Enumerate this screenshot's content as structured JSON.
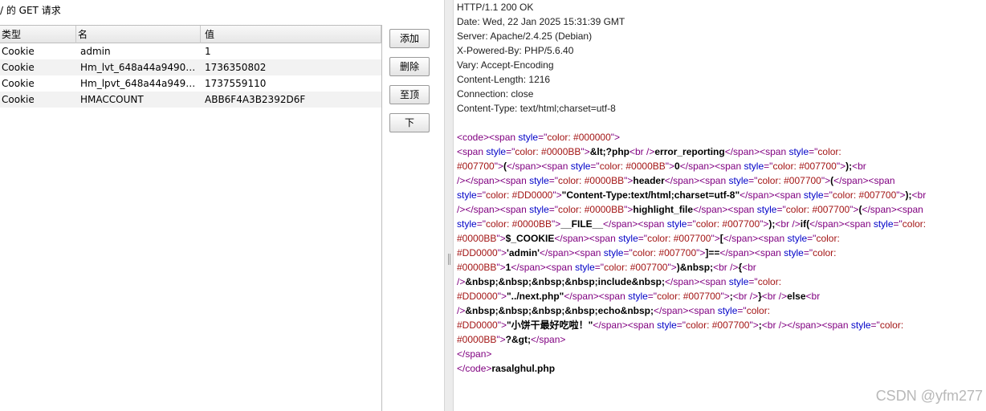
{
  "left": {
    "title": "/ 的 GET 请求",
    "columns": [
      "类型",
      "名",
      "值"
    ],
    "rows": [
      {
        "type": "Cookie",
        "name": "admin",
        "value": "1"
      },
      {
        "type": "Cookie",
        "name": "Hm_lvt_648a44a949074...",
        "value": "1736350802"
      },
      {
        "type": "Cookie",
        "name": "Hm_lpvt_648a44a9490...",
        "value": "1737559110"
      },
      {
        "type": "Cookie",
        "name": "HMACCOUNT",
        "value": "ABB6F4A3B2392D6F"
      }
    ],
    "buttons": {
      "add": "添加",
      "delete": "删除",
      "top": "至顶",
      "down": "下"
    }
  },
  "response": {
    "headers": [
      "HTTP/1.1 200 OK",
      "Date: Wed, 22 Jan 2025 15:31:39 GMT",
      "Server: Apache/2.4.25 (Debian)",
      "X-Powered-By: PHP/5.6.40",
      "Vary: Accept-Encoding",
      "Content-Length: 1216",
      "Connection: close",
      "Content-Type: text/html;charset=utf-8"
    ],
    "body_lines": [
      [
        [
          "tag",
          "<code><span "
        ],
        [
          "attr",
          "style"
        ],
        [
          "tag",
          "=\""
        ],
        [
          "val",
          "color: #000000"
        ],
        [
          "tag",
          "\">"
        ]
      ],
      [
        [
          "tag",
          "<span "
        ],
        [
          "attr",
          "style"
        ],
        [
          "tag",
          "=\""
        ],
        [
          "val",
          "color: #0000BB"
        ],
        [
          "tag",
          "\">"
        ],
        [
          "txt",
          "&lt;?php"
        ],
        [
          "tag",
          "<br />"
        ],
        [
          "txt",
          "error_reporting"
        ],
        [
          "tag",
          "</span><span "
        ],
        [
          "attr",
          "style"
        ],
        [
          "tag",
          "=\""
        ],
        [
          "val",
          "color:"
        ]
      ],
      [
        [
          "val",
          "#007700"
        ],
        [
          "tag",
          "\">"
        ],
        [
          "txt",
          "("
        ],
        [
          "tag",
          "</span><span "
        ],
        [
          "attr",
          "style"
        ],
        [
          "tag",
          "=\""
        ],
        [
          "val",
          "color: #0000BB"
        ],
        [
          "tag",
          "\">"
        ],
        [
          "txt",
          "0"
        ],
        [
          "tag",
          "</span><span "
        ],
        [
          "attr",
          "style"
        ],
        [
          "tag",
          "=\""
        ],
        [
          "val",
          "color: #007700"
        ],
        [
          "tag",
          "\">"
        ],
        [
          "txt",
          ");"
        ],
        [
          "tag",
          "<br"
        ]
      ],
      [
        [
          "tag",
          "/></span><span "
        ],
        [
          "attr",
          "style"
        ],
        [
          "tag",
          "=\""
        ],
        [
          "val",
          "color: #0000BB"
        ],
        [
          "tag",
          "\">"
        ],
        [
          "txt",
          "header"
        ],
        [
          "tag",
          "</span><span "
        ],
        [
          "attr",
          "style"
        ],
        [
          "tag",
          "=\""
        ],
        [
          "val",
          "color: #007700"
        ],
        [
          "tag",
          "\">"
        ],
        [
          "txt",
          "("
        ],
        [
          "tag",
          "</span><span"
        ]
      ],
      [
        [
          "attr",
          "style"
        ],
        [
          "tag",
          "=\""
        ],
        [
          "val",
          "color: #DD0000"
        ],
        [
          "tag",
          "\">"
        ],
        [
          "txt",
          "\"Content-Type:text/html;charset=utf-8\""
        ],
        [
          "tag",
          "</span><span "
        ],
        [
          "attr",
          "style"
        ],
        [
          "tag",
          "=\""
        ],
        [
          "val",
          "color: #007700"
        ],
        [
          "tag",
          "\">"
        ],
        [
          "txt",
          ");"
        ],
        [
          "tag",
          "<br"
        ]
      ],
      [
        [
          "tag",
          "/></span><span "
        ],
        [
          "attr",
          "style"
        ],
        [
          "tag",
          "=\""
        ],
        [
          "val",
          "color: #0000BB"
        ],
        [
          "tag",
          "\">"
        ],
        [
          "txt",
          "highlight_file"
        ],
        [
          "tag",
          "</span><span "
        ],
        [
          "attr",
          "style"
        ],
        [
          "tag",
          "=\""
        ],
        [
          "val",
          "color: #007700"
        ],
        [
          "tag",
          "\">"
        ],
        [
          "txt",
          "("
        ],
        [
          "tag",
          "</span><span"
        ]
      ],
      [
        [
          "attr",
          "style"
        ],
        [
          "tag",
          "=\""
        ],
        [
          "val",
          "color: #0000BB"
        ],
        [
          "tag",
          "\">"
        ],
        [
          "txt",
          "__FILE__"
        ],
        [
          "tag",
          "</span><span "
        ],
        [
          "attr",
          "style"
        ],
        [
          "tag",
          "=\""
        ],
        [
          "val",
          "color: #007700"
        ],
        [
          "tag",
          "\">"
        ],
        [
          "txt",
          ");"
        ],
        [
          "tag",
          "<br />"
        ],
        [
          "txt",
          "if("
        ],
        [
          "tag",
          "</span><span "
        ],
        [
          "attr",
          "style"
        ],
        [
          "tag",
          "=\""
        ],
        [
          "val",
          "color:"
        ]
      ],
      [
        [
          "val",
          "#0000BB"
        ],
        [
          "tag",
          "\">"
        ],
        [
          "txt",
          "$_COOKIE"
        ],
        [
          "tag",
          "</span><span "
        ],
        [
          "attr",
          "style"
        ],
        [
          "tag",
          "=\""
        ],
        [
          "val",
          "color: #007700"
        ],
        [
          "tag",
          "\">"
        ],
        [
          "txt",
          "["
        ],
        [
          "tag",
          "</span><span "
        ],
        [
          "attr",
          "style"
        ],
        [
          "tag",
          "=\""
        ],
        [
          "val",
          "color:"
        ]
      ],
      [
        [
          "val",
          "#DD0000"
        ],
        [
          "tag",
          "\">"
        ],
        [
          "txt",
          "'admin'"
        ],
        [
          "tag",
          "</span><span "
        ],
        [
          "attr",
          "style"
        ],
        [
          "tag",
          "=\""
        ],
        [
          "val",
          "color: #007700"
        ],
        [
          "tag",
          "\">"
        ],
        [
          "txt",
          "]=="
        ],
        [
          "tag",
          "</span><span "
        ],
        [
          "attr",
          "style"
        ],
        [
          "tag",
          "=\""
        ],
        [
          "val",
          "color:"
        ]
      ],
      [
        [
          "val",
          "#0000BB"
        ],
        [
          "tag",
          "\">"
        ],
        [
          "txt",
          "1"
        ],
        [
          "tag",
          "</span><span "
        ],
        [
          "attr",
          "style"
        ],
        [
          "tag",
          "=\""
        ],
        [
          "val",
          "color: #007700"
        ],
        [
          "tag",
          "\">"
        ],
        [
          "txt",
          ")&nbsp;"
        ],
        [
          "tag",
          "<br />"
        ],
        [
          "txt",
          "{"
        ],
        [
          "tag",
          "<br"
        ]
      ],
      [
        [
          "tag",
          "/>"
        ],
        [
          "txt",
          "&nbsp;&nbsp;&nbsp;&nbsp;include&nbsp;"
        ],
        [
          "tag",
          "</span><span "
        ],
        [
          "attr",
          "style"
        ],
        [
          "tag",
          "=\""
        ],
        [
          "val",
          "color:"
        ]
      ],
      [
        [
          "val",
          "#DD0000"
        ],
        [
          "tag",
          "\">"
        ],
        [
          "txt",
          "\"../next.php\""
        ],
        [
          "tag",
          "</span><span "
        ],
        [
          "attr",
          "style"
        ],
        [
          "tag",
          "=\""
        ],
        [
          "val",
          "color: #007700"
        ],
        [
          "tag",
          "\">"
        ],
        [
          "txt",
          ";"
        ],
        [
          "tag",
          "<br />"
        ],
        [
          "txt",
          "}"
        ],
        [
          "tag",
          "<br />"
        ],
        [
          "txt",
          "else"
        ],
        [
          "tag",
          "<br"
        ]
      ],
      [
        [
          "tag",
          "/>"
        ],
        [
          "txt",
          "&nbsp;&nbsp;&nbsp;&nbsp;echo&nbsp;"
        ],
        [
          "tag",
          "</span><span "
        ],
        [
          "attr",
          "style"
        ],
        [
          "tag",
          "=\""
        ],
        [
          "val",
          "color:"
        ]
      ],
      [
        [
          "val",
          "#DD0000"
        ],
        [
          "tag",
          "\">"
        ],
        [
          "txt",
          "\"小饼干最好吃啦！\""
        ],
        [
          "tag",
          "</span><span "
        ],
        [
          "attr",
          "style"
        ],
        [
          "tag",
          "=\""
        ],
        [
          "val",
          "color: #007700"
        ],
        [
          "tag",
          "\">"
        ],
        [
          "txt",
          ";"
        ],
        [
          "tag",
          "<br /></span><span "
        ],
        [
          "attr",
          "style"
        ],
        [
          "tag",
          "=\""
        ],
        [
          "val",
          "color:"
        ]
      ],
      [
        [
          "val",
          "#0000BB"
        ],
        [
          "tag",
          "\">"
        ],
        [
          "txt",
          "?&gt;"
        ],
        [
          "tag",
          "</span>"
        ]
      ],
      [
        [
          "tag",
          "</span>"
        ]
      ],
      [
        [
          "tag",
          "</code>"
        ],
        [
          "txt",
          "rasalghul.php"
        ]
      ]
    ]
  },
  "watermark": "CSDN @yfm277"
}
